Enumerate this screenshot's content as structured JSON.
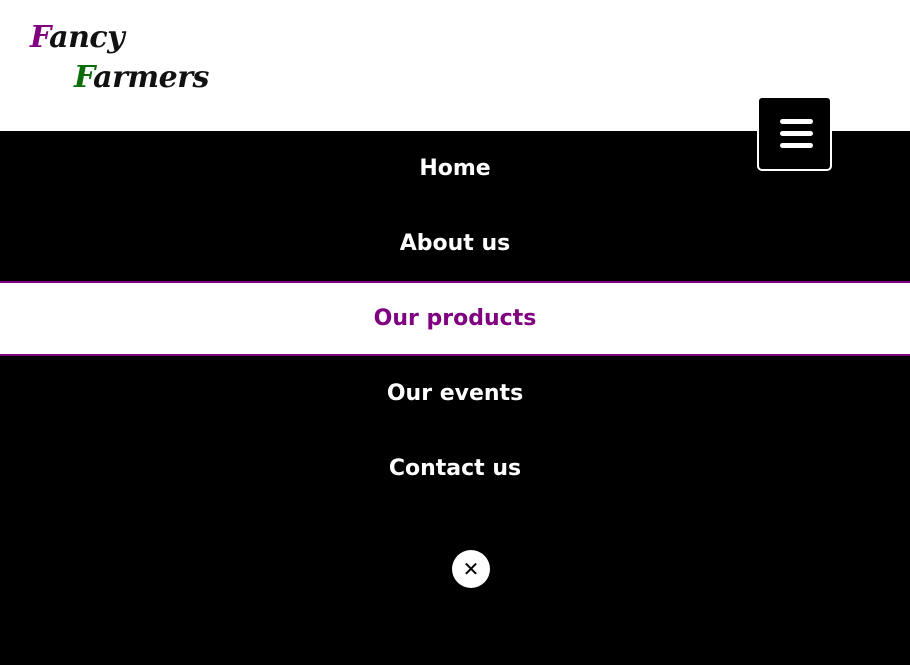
{
  "logo": {
    "line1_cap": "F",
    "line1_rest": "ancy",
    "line2_cap": "F",
    "line2_rest": "armers"
  },
  "menu_button": {
    "icon": "hamburger-menu-icon"
  },
  "nav": {
    "items": [
      {
        "label": "Home",
        "active": false
      },
      {
        "label": "About us",
        "active": false
      },
      {
        "label": "Our products",
        "active": true
      },
      {
        "label": "Our events",
        "active": false
      },
      {
        "label": "Contact us",
        "active": false
      }
    ]
  },
  "close_button": {
    "icon": "close-icon",
    "glyph": "✕"
  },
  "colors": {
    "accent_purple": "#800080",
    "accent_green": "#0b6e0b",
    "menu_background": "#000000",
    "header_background": "#ffffff"
  }
}
